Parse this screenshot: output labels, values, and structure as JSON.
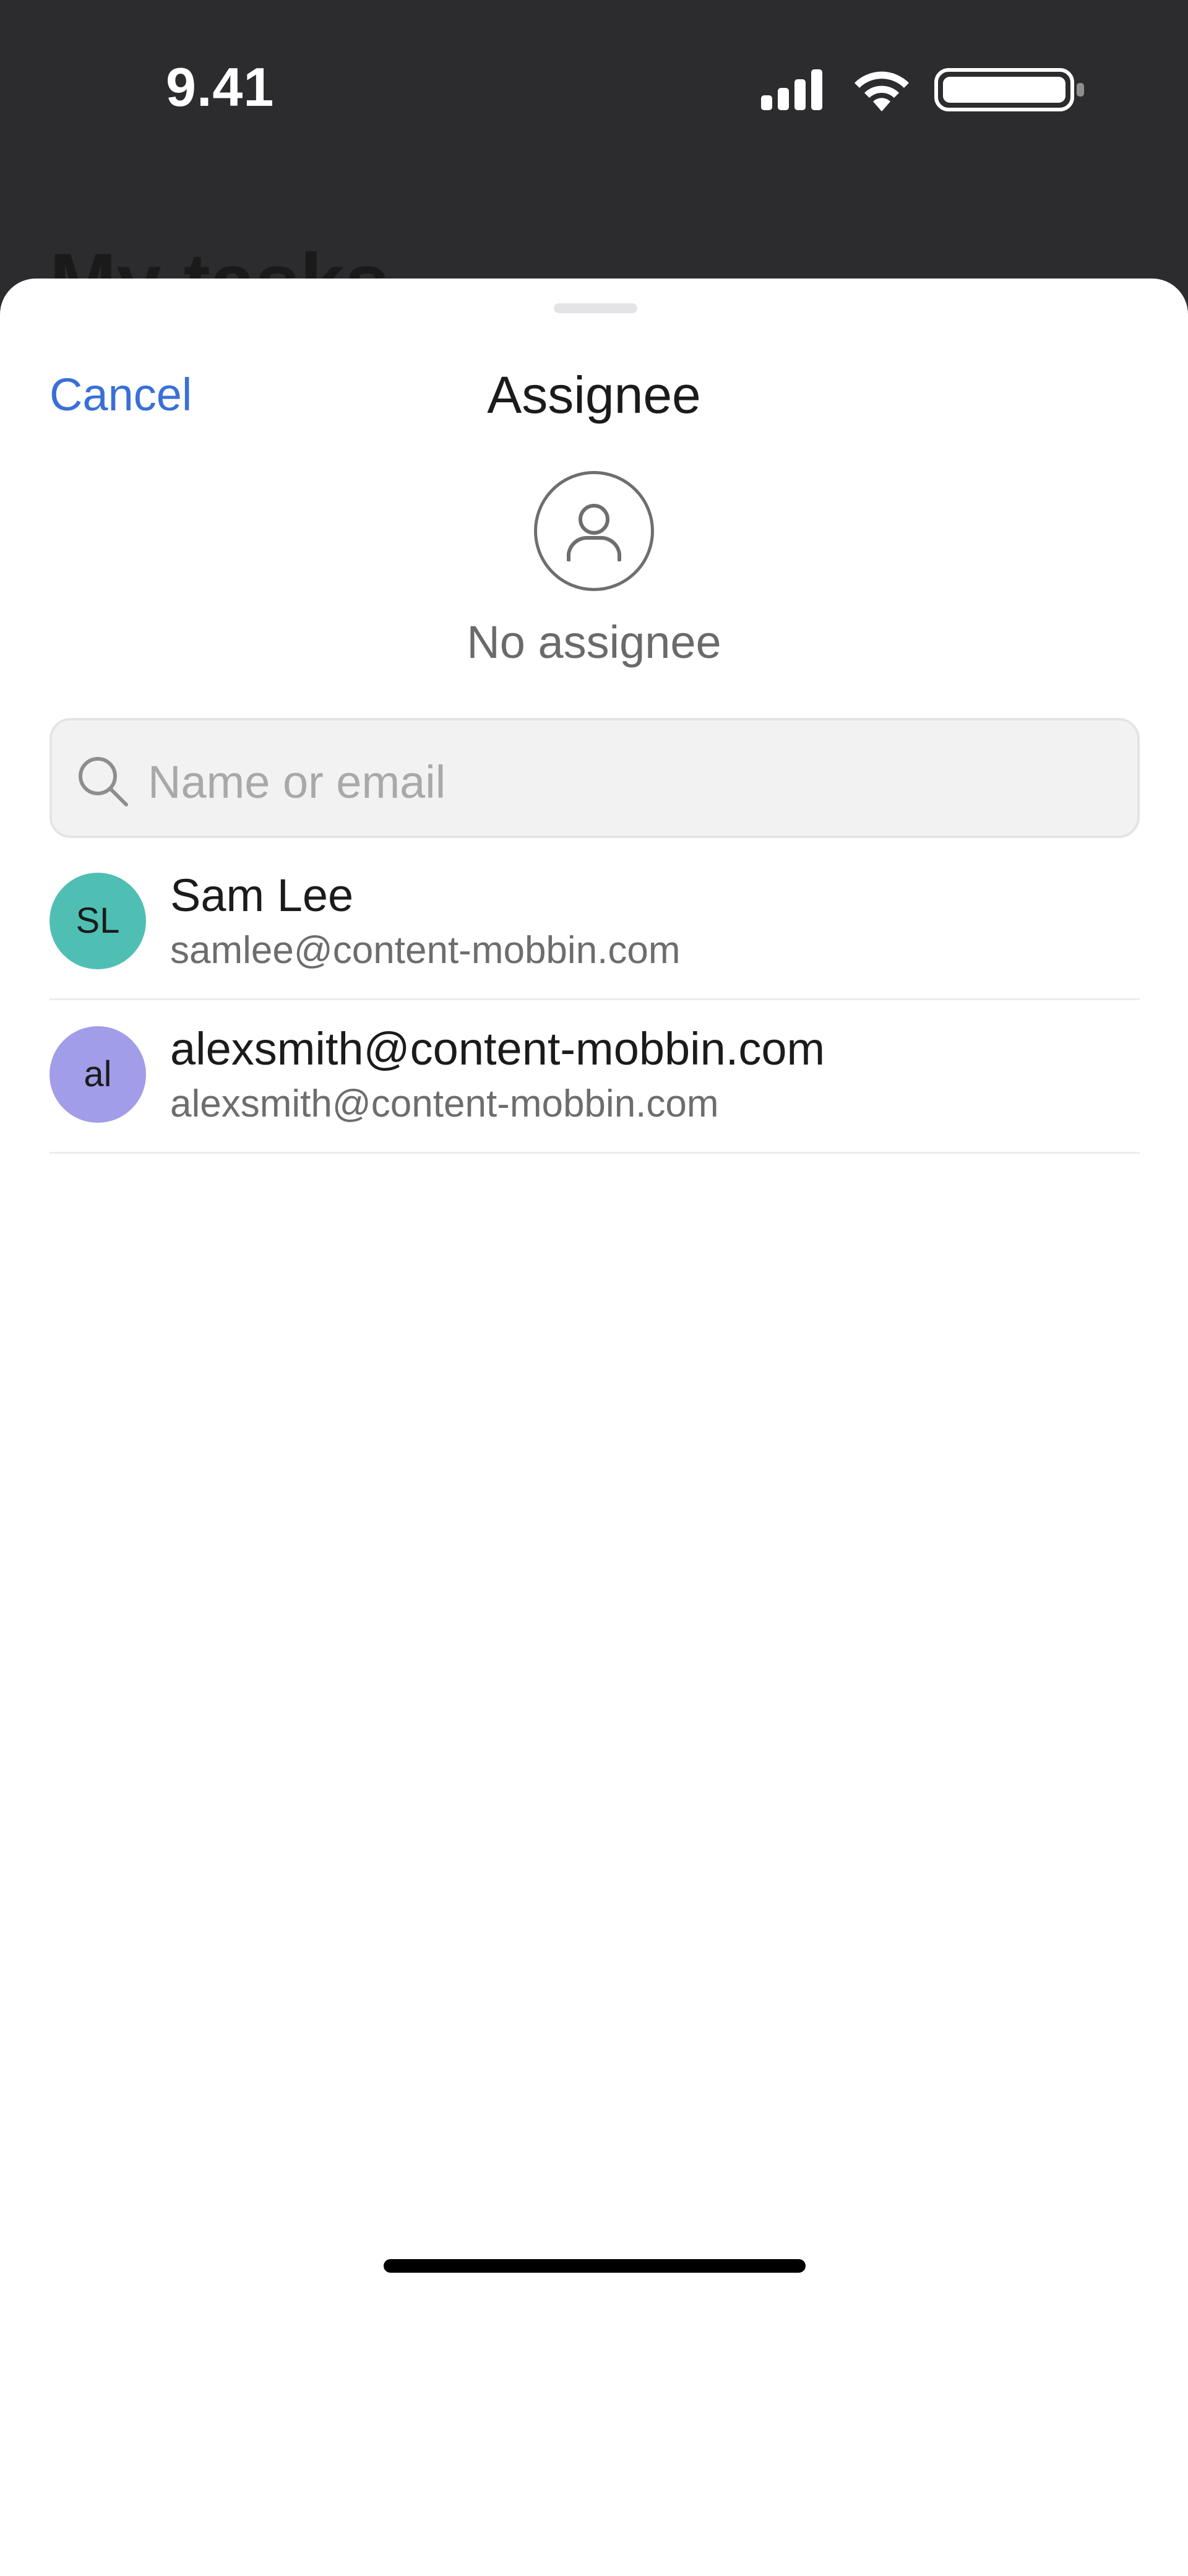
{
  "status_bar": {
    "time": "9.41",
    "icons": [
      "signal-icon",
      "wifi-icon",
      "battery-icon"
    ]
  },
  "background": {
    "title": "My tasks"
  },
  "sheet": {
    "cancel_label": "Cancel",
    "title": "Assignee",
    "no_assignee_label": "No assignee",
    "search": {
      "placeholder": "Name or email"
    },
    "assignees": [
      {
        "initials": "SL",
        "name": "Sam Lee",
        "email": "samlee@content-mobbin.com",
        "color": "#4fbfb4"
      },
      {
        "initials": "al",
        "name": "alexsmith@content-mobbin.com",
        "email": "alexsmith@content-mobbin.com",
        "color": "#a19de8"
      }
    ]
  },
  "colors": {
    "accent": "#3a6fd8",
    "status_bar_bg": "#2c2c2e"
  }
}
